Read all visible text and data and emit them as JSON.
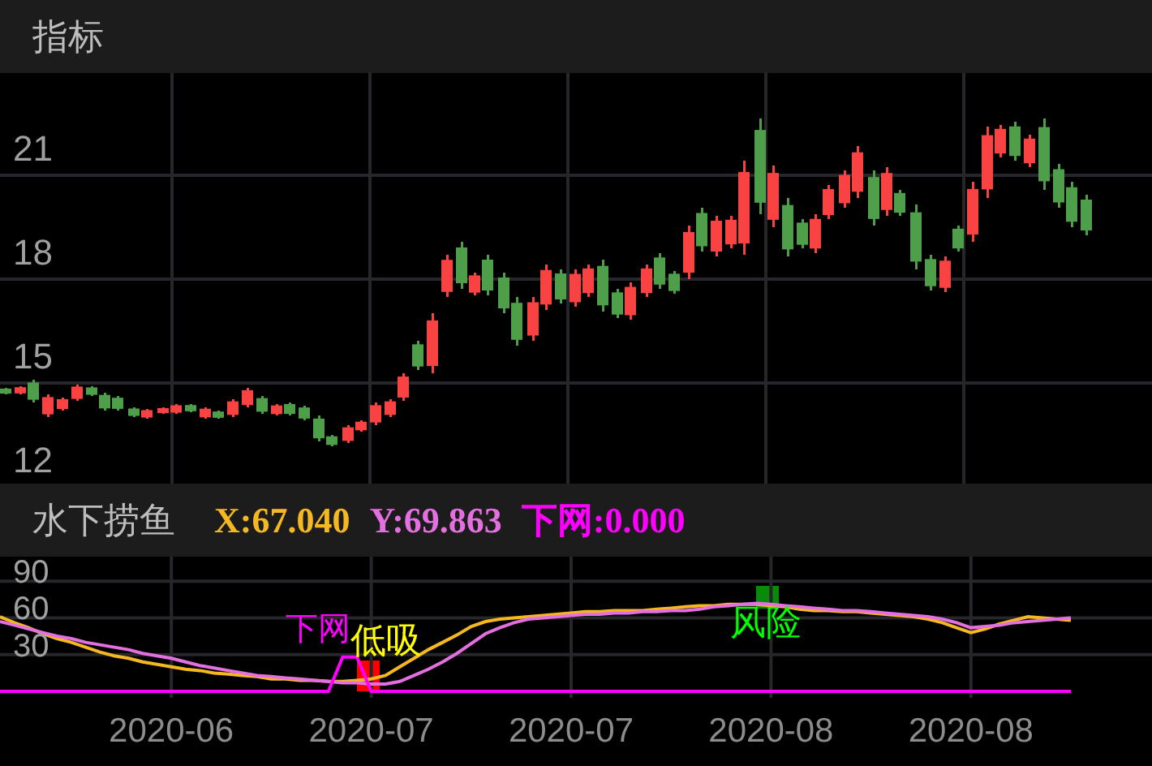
{
  "header": {
    "title": "指标"
  },
  "price_chart": {
    "y_labels": [
      "21",
      "18",
      "15",
      "12"
    ]
  },
  "indicator": {
    "name": "水下捞鱼",
    "readings": [
      ":67.040",
      ":69.863",
      ":0.000"
    ]
  },
  "oscillator": {
    "chart_data": {
      "type": "line",
      "grid": true,
      "ylim": [
        -61,
        110
      ],
      "yticks": [
        90,
        60,
        30
      ],
      "categories": [
        null,
        null,
        null,
        null,
        null,
        null,
        null,
        null,
        null,
        null,
        null,
        null,
        "2020-06",
        null,
        null,
        null,
        null,
        null,
        null,
        null,
        null,
        null,
        null,
        null,
        null,
        null,
        "2020-07",
        null,
        null,
        null,
        null,
        null,
        null,
        null,
        null,
        null,
        null,
        null,
        null,
        null,
        "2020-07",
        null,
        null,
        null,
        null,
        null,
        null,
        null,
        null,
        null,
        null,
        null,
        null,
        null,
        "2020-08",
        null,
        null,
        null,
        null,
        null,
        null,
        null,
        null,
        null,
        null,
        null,
        null,
        null,
        "2020-08",
        null,
        null,
        null,
        null,
        null,
        null,
        null
      ],
      "series": [
        {
          "name": "X",
          "color": "#f5b821",
          "values": [
            61,
            56,
            52,
            47,
            43,
            40,
            36,
            32,
            29,
            27,
            24,
            22,
            20,
            18,
            17,
            15,
            14,
            13,
            12,
            10,
            10,
            9,
            9,
            8,
            8,
            9,
            10,
            13,
            20,
            27,
            34,
            40,
            46,
            53,
            57,
            59,
            60,
            61,
            62,
            63,
            64,
            65,
            65,
            66,
            66,
            66,
            67,
            68,
            69,
            70,
            70,
            71,
            71,
            71,
            70,
            69,
            67,
            66,
            66,
            65,
            65,
            64,
            63,
            62,
            61,
            59,
            56,
            52,
            48,
            51,
            55,
            58,
            61,
            60,
            59,
            58
          ]
        },
        {
          "name": "Y",
          "color": "#e46fe0",
          "values": [
            57,
            54,
            51,
            48,
            45,
            43,
            40,
            38,
            36,
            34,
            31,
            29,
            27,
            24,
            21,
            19,
            17,
            15,
            13,
            12,
            11,
            10,
            9,
            8,
            7,
            7,
            6,
            6,
            8,
            13,
            18,
            24,
            31,
            39,
            47,
            52,
            56,
            59,
            60,
            61,
            62,
            63,
            63,
            64,
            64,
            65,
            65,
            66,
            66,
            67,
            69,
            70,
            71,
            72,
            71,
            70,
            69,
            68,
            67,
            66,
            66,
            65,
            64,
            63,
            62,
            61,
            59,
            56,
            52,
            53,
            54,
            56,
            57,
            58,
            59,
            60
          ]
        },
        {
          "name": "下网",
          "color": "#ff00ff",
          "values": [
            0,
            0,
            0,
            0,
            0,
            0,
            0,
            0,
            0,
            0,
            0,
            0,
            0,
            0,
            0,
            0,
            0,
            0,
            0,
            0,
            0,
            0,
            0,
            0,
            28,
            28,
            0,
            0,
            0,
            0,
            0,
            0,
            0,
            0,
            0,
            0,
            0,
            0,
            0,
            0,
            0,
            0,
            0,
            0,
            0,
            0,
            0,
            0,
            0,
            0,
            0,
            0,
            0,
            0,
            0,
            0,
            0,
            0,
            0,
            0,
            0,
            0,
            0,
            0,
            0,
            0,
            0,
            0,
            0,
            0,
            0,
            0,
            0,
            0,
            0,
            0
          ]
        }
      ]
    },
    "signals": [
      {
        "text": "下网",
        "color": "#ff00ff"
      },
      {
        "text": "低吸",
        "color": "#ffff00"
      },
      {
        "text": "风险",
        "color": "#00ff00"
      }
    ]
  }
}
